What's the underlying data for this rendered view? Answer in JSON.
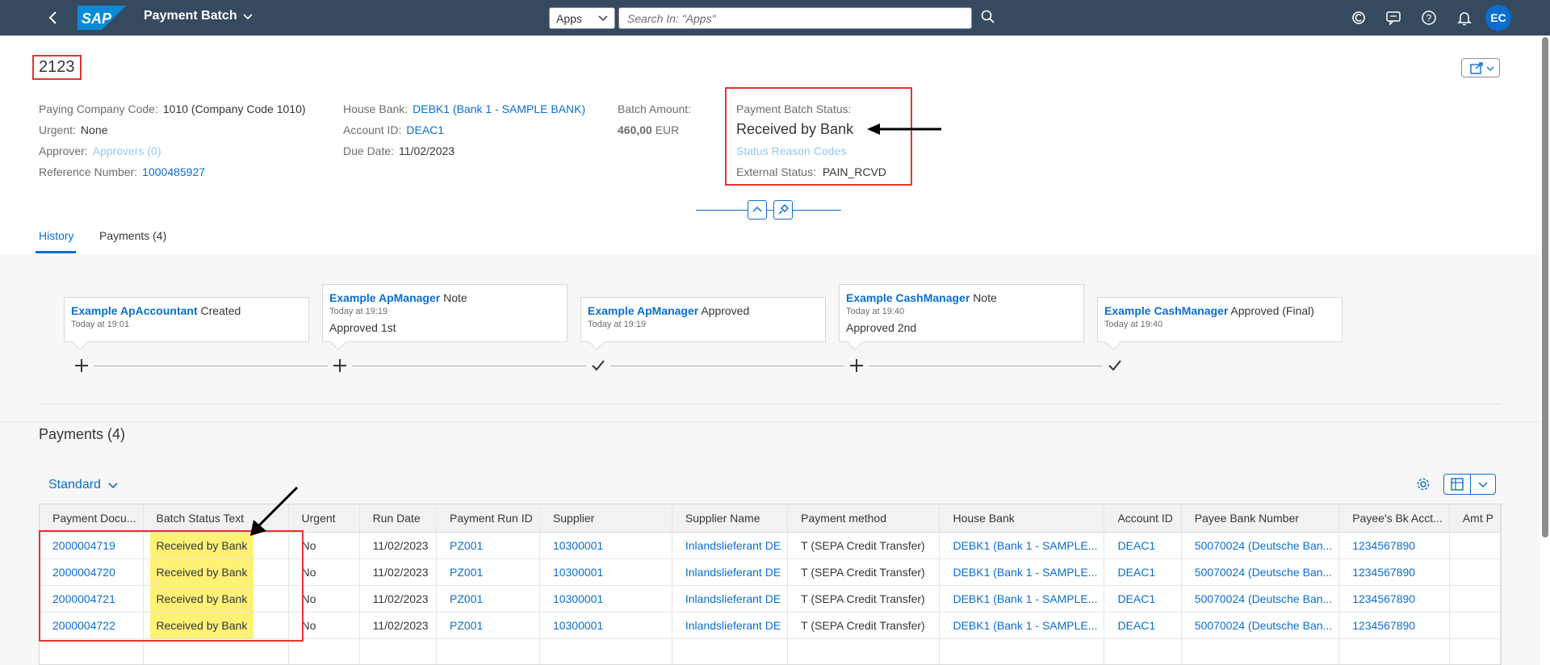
{
  "shell": {
    "app_title": "Payment Batch",
    "apps_select": "Apps",
    "search_placeholder": "Search In: \"Apps\"",
    "avatar_initials": "EC"
  },
  "header": {
    "object_id": "2123",
    "paying_company_code": {
      "label": "Paying Company Code:",
      "value": "1010 (Company Code 1010)"
    },
    "urgent": {
      "label": "Urgent:",
      "value": "None"
    },
    "approver": {
      "label": "Approver:",
      "value": "Approvers (0)"
    },
    "reference_number": {
      "label": "Reference Number:",
      "value": "1000485927"
    },
    "house_bank": {
      "label": "House Bank:",
      "value": "DEBK1 (Bank 1 - SAMPLE BANK)"
    },
    "account_id": {
      "label": "Account ID:",
      "value": "DEAC1"
    },
    "due_date": {
      "label": "Due Date:",
      "value": "11/02/2023"
    },
    "batch_amount": {
      "label": "Batch Amount:",
      "value": "460,00",
      "currency": "EUR"
    },
    "status": {
      "label": "Payment Batch Status:",
      "value": "Received by Bank",
      "reason_codes": "Status Reason Codes",
      "external_label": "External Status:",
      "external_value": "PAIN_RCVD"
    }
  },
  "tabs": [
    {
      "label": "History"
    },
    {
      "label": "Payments (4)"
    }
  ],
  "history": [
    {
      "user": "Example ApAccountant",
      "action": "Created",
      "time": "Today at 19:01",
      "note": "",
      "icon": "plus-icon"
    },
    {
      "user": "Example ApManager",
      "action": "Note",
      "time": "Today at 19:19",
      "note": "Approved 1st",
      "icon": "plus-icon"
    },
    {
      "user": "Example ApManager",
      "action": "Approved",
      "time": "Today at 19:19",
      "note": "",
      "icon": "check-icon"
    },
    {
      "user": "Example CashManager",
      "action": "Note",
      "time": "Today at 19:40",
      "note": "Approved 2nd",
      "icon": "plus-icon"
    },
    {
      "user": "Example CashManager",
      "action": "Approved (Final)",
      "time": "Today at 19:40",
      "note": "",
      "icon": "check-icon"
    }
  ],
  "payments": {
    "title": "Payments (4)",
    "variant": "Standard",
    "columns": [
      "Payment Docu...",
      "Batch Status Text",
      "Urgent",
      "Run Date",
      "Payment Run ID",
      "Supplier",
      "Supplier Name",
      "Payment method",
      "House Bank",
      "Account ID",
      "Payee Bank Number",
      "Payee's Bk Acct...",
      "Amt P"
    ],
    "rows": [
      [
        "2000004719",
        "Received by Bank",
        "No",
        "11/02/2023",
        "PZ001",
        "10300001",
        "Inlandslieferant DE",
        "T (SEPA Credit Transfer)",
        "DEBK1 (Bank 1 - SAMPLE...",
        "DEAC1",
        "50070024 (Deutsche Ban...",
        "1234567890",
        ""
      ],
      [
        "2000004720",
        "Received by Bank",
        "No",
        "11/02/2023",
        "PZ001",
        "10300001",
        "Inlandslieferant DE",
        "T (SEPA Credit Transfer)",
        "DEBK1 (Bank 1 - SAMPLE...",
        "DEAC1",
        "50070024 (Deutsche Ban...",
        "1234567890",
        ""
      ],
      [
        "2000004721",
        "Received by Bank",
        "No",
        "11/02/2023",
        "PZ001",
        "10300001",
        "Inlandslieferant DE",
        "T (SEPA Credit Transfer)",
        "DEBK1 (Bank 1 - SAMPLE...",
        "DEAC1",
        "50070024 (Deutsche Ban...",
        "1234567890",
        ""
      ],
      [
        "2000004722",
        "Received by Bank",
        "No",
        "11/02/2023",
        "PZ001",
        "10300001",
        "Inlandslieferant DE",
        "T (SEPA Credit Transfer)",
        "DEBK1 (Bank 1 - SAMPLE...",
        "DEAC1",
        "50070024 (Deutsche Ban...",
        "1234567890",
        ""
      ]
    ]
  },
  "colors": {
    "shell": "#354a5f",
    "link": "#0a6ed1",
    "highlight": "#fff176",
    "annotation": "#e8312f"
  }
}
